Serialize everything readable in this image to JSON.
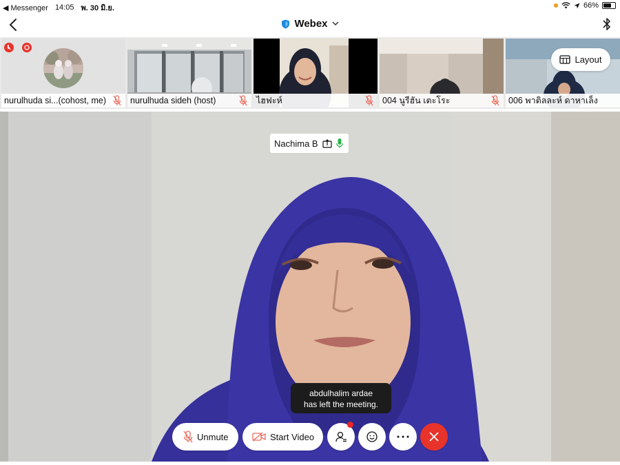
{
  "status_bar": {
    "back_app": "◀ Messenger",
    "time": "14:05",
    "date": "พ. 30 มิ.ย.",
    "battery": "66%",
    "battery_level": 0.66
  },
  "nav": {
    "title": "Webex"
  },
  "thumbnails": [
    {
      "label": "nurulhuda si...(cohost, me)"
    },
    {
      "label": "nurulhuda sideh (host)"
    },
    {
      "label": "ไฮฟะห์"
    },
    {
      "label": "004 นูรีฮัน เตะโระ"
    },
    {
      "label": "006 พาติลละห์ ดาหาเล็ง"
    }
  ],
  "layout_button": {
    "label": "Layout"
  },
  "active_speaker": {
    "name": "Nachima B"
  },
  "toast": {
    "line1": "abdulhalim ardae",
    "line2": "has left the meeting."
  },
  "controls": {
    "unmute": "Unmute",
    "start_video": "Start Video"
  },
  "colors": {
    "accent_red": "#e8332a",
    "mic_muted": "#e86a5c",
    "mic_active": "#2bb24c",
    "shield": "#1f8ad9"
  }
}
